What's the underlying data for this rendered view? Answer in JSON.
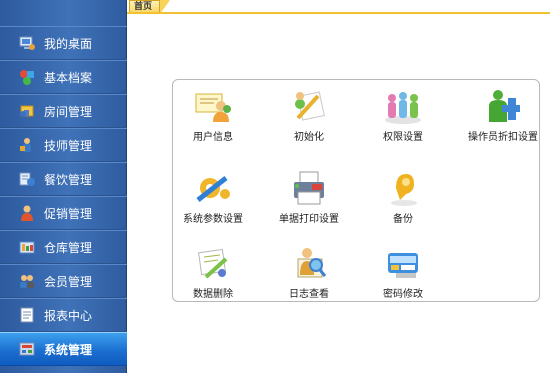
{
  "tabs": [
    {
      "label": "首页"
    }
  ],
  "sidebar": {
    "items": [
      {
        "label": "我的桌面",
        "icon": "desktop-icon"
      },
      {
        "label": "基本档案",
        "icon": "shapes-icon"
      },
      {
        "label": "房间管理",
        "icon": "room-icon"
      },
      {
        "label": "技师管理",
        "icon": "technician-icon"
      },
      {
        "label": "餐饮管理",
        "icon": "dining-icon"
      },
      {
        "label": "促销管理",
        "icon": "promotion-icon"
      },
      {
        "label": "仓库管理",
        "icon": "warehouse-icon"
      },
      {
        "label": "会员管理",
        "icon": "members-icon"
      },
      {
        "label": "报表中心",
        "icon": "report-icon"
      },
      {
        "label": "系统管理",
        "icon": "system-icon",
        "active": true
      }
    ]
  },
  "functions": [
    {
      "label": "用户信息",
      "icon": "user-info-icon"
    },
    {
      "label": "初始化",
      "icon": "initialize-icon"
    },
    {
      "label": "权限设置",
      "icon": "permissions-icon"
    },
    {
      "label": "操作员折扣设置",
      "icon": "operator-discount-icon"
    },
    {
      "label": "系统参数设置",
      "icon": "system-params-icon"
    },
    {
      "label": "单据打印设置",
      "icon": "print-settings-icon"
    },
    {
      "label": "备份",
      "icon": "backup-icon"
    },
    {
      "label": "数据删除",
      "icon": "data-delete-icon"
    },
    {
      "label": "日志查看",
      "icon": "log-view-icon"
    },
    {
      "label": "密码修改",
      "icon": "password-change-icon"
    }
  ]
}
